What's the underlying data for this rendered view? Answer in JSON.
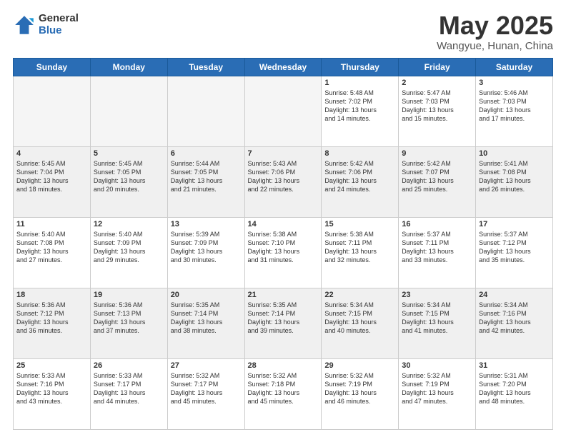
{
  "header": {
    "logo_general": "General",
    "logo_blue": "Blue",
    "month_title": "May 2025",
    "location": "Wangyue, Hunan, China"
  },
  "weekdays": [
    "Sunday",
    "Monday",
    "Tuesday",
    "Wednesday",
    "Thursday",
    "Friday",
    "Saturday"
  ],
  "rows": [
    {
      "shaded": false,
      "cells": [
        {
          "day": null,
          "info": null
        },
        {
          "day": null,
          "info": null
        },
        {
          "day": null,
          "info": null
        },
        {
          "day": null,
          "info": null
        },
        {
          "day": "1",
          "info": "Sunrise: 5:48 AM\nSunset: 7:02 PM\nDaylight: 13 hours\nand 14 minutes."
        },
        {
          "day": "2",
          "info": "Sunrise: 5:47 AM\nSunset: 7:03 PM\nDaylight: 13 hours\nand 15 minutes."
        },
        {
          "day": "3",
          "info": "Sunrise: 5:46 AM\nSunset: 7:03 PM\nDaylight: 13 hours\nand 17 minutes."
        }
      ]
    },
    {
      "shaded": true,
      "cells": [
        {
          "day": "4",
          "info": "Sunrise: 5:45 AM\nSunset: 7:04 PM\nDaylight: 13 hours\nand 18 minutes."
        },
        {
          "day": "5",
          "info": "Sunrise: 5:45 AM\nSunset: 7:05 PM\nDaylight: 13 hours\nand 20 minutes."
        },
        {
          "day": "6",
          "info": "Sunrise: 5:44 AM\nSunset: 7:05 PM\nDaylight: 13 hours\nand 21 minutes."
        },
        {
          "day": "7",
          "info": "Sunrise: 5:43 AM\nSunset: 7:06 PM\nDaylight: 13 hours\nand 22 minutes."
        },
        {
          "day": "8",
          "info": "Sunrise: 5:42 AM\nSunset: 7:06 PM\nDaylight: 13 hours\nand 24 minutes."
        },
        {
          "day": "9",
          "info": "Sunrise: 5:42 AM\nSunset: 7:07 PM\nDaylight: 13 hours\nand 25 minutes."
        },
        {
          "day": "10",
          "info": "Sunrise: 5:41 AM\nSunset: 7:08 PM\nDaylight: 13 hours\nand 26 minutes."
        }
      ]
    },
    {
      "shaded": false,
      "cells": [
        {
          "day": "11",
          "info": "Sunrise: 5:40 AM\nSunset: 7:08 PM\nDaylight: 13 hours\nand 27 minutes."
        },
        {
          "day": "12",
          "info": "Sunrise: 5:40 AM\nSunset: 7:09 PM\nDaylight: 13 hours\nand 29 minutes."
        },
        {
          "day": "13",
          "info": "Sunrise: 5:39 AM\nSunset: 7:09 PM\nDaylight: 13 hours\nand 30 minutes."
        },
        {
          "day": "14",
          "info": "Sunrise: 5:38 AM\nSunset: 7:10 PM\nDaylight: 13 hours\nand 31 minutes."
        },
        {
          "day": "15",
          "info": "Sunrise: 5:38 AM\nSunset: 7:11 PM\nDaylight: 13 hours\nand 32 minutes."
        },
        {
          "day": "16",
          "info": "Sunrise: 5:37 AM\nSunset: 7:11 PM\nDaylight: 13 hours\nand 33 minutes."
        },
        {
          "day": "17",
          "info": "Sunrise: 5:37 AM\nSunset: 7:12 PM\nDaylight: 13 hours\nand 35 minutes."
        }
      ]
    },
    {
      "shaded": true,
      "cells": [
        {
          "day": "18",
          "info": "Sunrise: 5:36 AM\nSunset: 7:12 PM\nDaylight: 13 hours\nand 36 minutes."
        },
        {
          "day": "19",
          "info": "Sunrise: 5:36 AM\nSunset: 7:13 PM\nDaylight: 13 hours\nand 37 minutes."
        },
        {
          "day": "20",
          "info": "Sunrise: 5:35 AM\nSunset: 7:14 PM\nDaylight: 13 hours\nand 38 minutes."
        },
        {
          "day": "21",
          "info": "Sunrise: 5:35 AM\nSunset: 7:14 PM\nDaylight: 13 hours\nand 39 minutes."
        },
        {
          "day": "22",
          "info": "Sunrise: 5:34 AM\nSunset: 7:15 PM\nDaylight: 13 hours\nand 40 minutes."
        },
        {
          "day": "23",
          "info": "Sunrise: 5:34 AM\nSunset: 7:15 PM\nDaylight: 13 hours\nand 41 minutes."
        },
        {
          "day": "24",
          "info": "Sunrise: 5:34 AM\nSunset: 7:16 PM\nDaylight: 13 hours\nand 42 minutes."
        }
      ]
    },
    {
      "shaded": false,
      "cells": [
        {
          "day": "25",
          "info": "Sunrise: 5:33 AM\nSunset: 7:16 PM\nDaylight: 13 hours\nand 43 minutes."
        },
        {
          "day": "26",
          "info": "Sunrise: 5:33 AM\nSunset: 7:17 PM\nDaylight: 13 hours\nand 44 minutes."
        },
        {
          "day": "27",
          "info": "Sunrise: 5:32 AM\nSunset: 7:17 PM\nDaylight: 13 hours\nand 45 minutes."
        },
        {
          "day": "28",
          "info": "Sunrise: 5:32 AM\nSunset: 7:18 PM\nDaylight: 13 hours\nand 45 minutes."
        },
        {
          "day": "29",
          "info": "Sunrise: 5:32 AM\nSunset: 7:19 PM\nDaylight: 13 hours\nand 46 minutes."
        },
        {
          "day": "30",
          "info": "Sunrise: 5:32 AM\nSunset: 7:19 PM\nDaylight: 13 hours\nand 47 minutes."
        },
        {
          "day": "31",
          "info": "Sunrise: 5:31 AM\nSunset: 7:20 PM\nDaylight: 13 hours\nand 48 minutes."
        }
      ]
    }
  ]
}
